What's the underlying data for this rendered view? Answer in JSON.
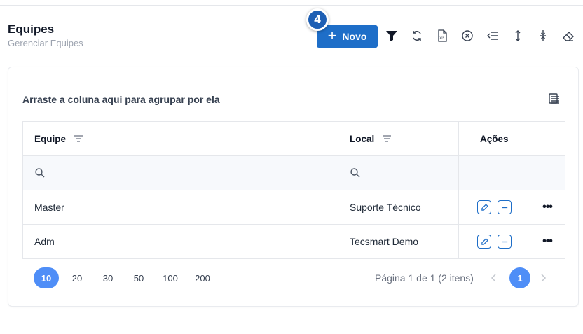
{
  "header": {
    "title": "Equipes",
    "subtitle": "Gerenciar Equipes",
    "badge": "4",
    "new_button_label": "Novo"
  },
  "toolbar": {
    "icons": [
      "filter-icon",
      "refresh-icon",
      "export-xls-icon",
      "clear-filter-icon",
      "collapse-left-icon",
      "expand-rows-icon",
      "collapse-rows-icon",
      "eraser-icon"
    ]
  },
  "grid": {
    "group_hint": "Arraste a coluna aqui para agrupar por ela",
    "columns": [
      "Equipe",
      "Local",
      "Ações"
    ],
    "rows": [
      {
        "equipe": "Master",
        "local": "Suporte Técnico"
      },
      {
        "equipe": "Adm",
        "local": "Tecsmart Demo"
      }
    ]
  },
  "pager": {
    "sizes": [
      "10",
      "20",
      "30",
      "50",
      "100",
      "200"
    ],
    "active_size": "10",
    "info": "Página 1 de 1 (2 itens)",
    "current_page": "1"
  },
  "colors": {
    "accent": "#1e6ec8",
    "badge": "#1e5fb4",
    "pager_active": "#4f8ef7"
  }
}
